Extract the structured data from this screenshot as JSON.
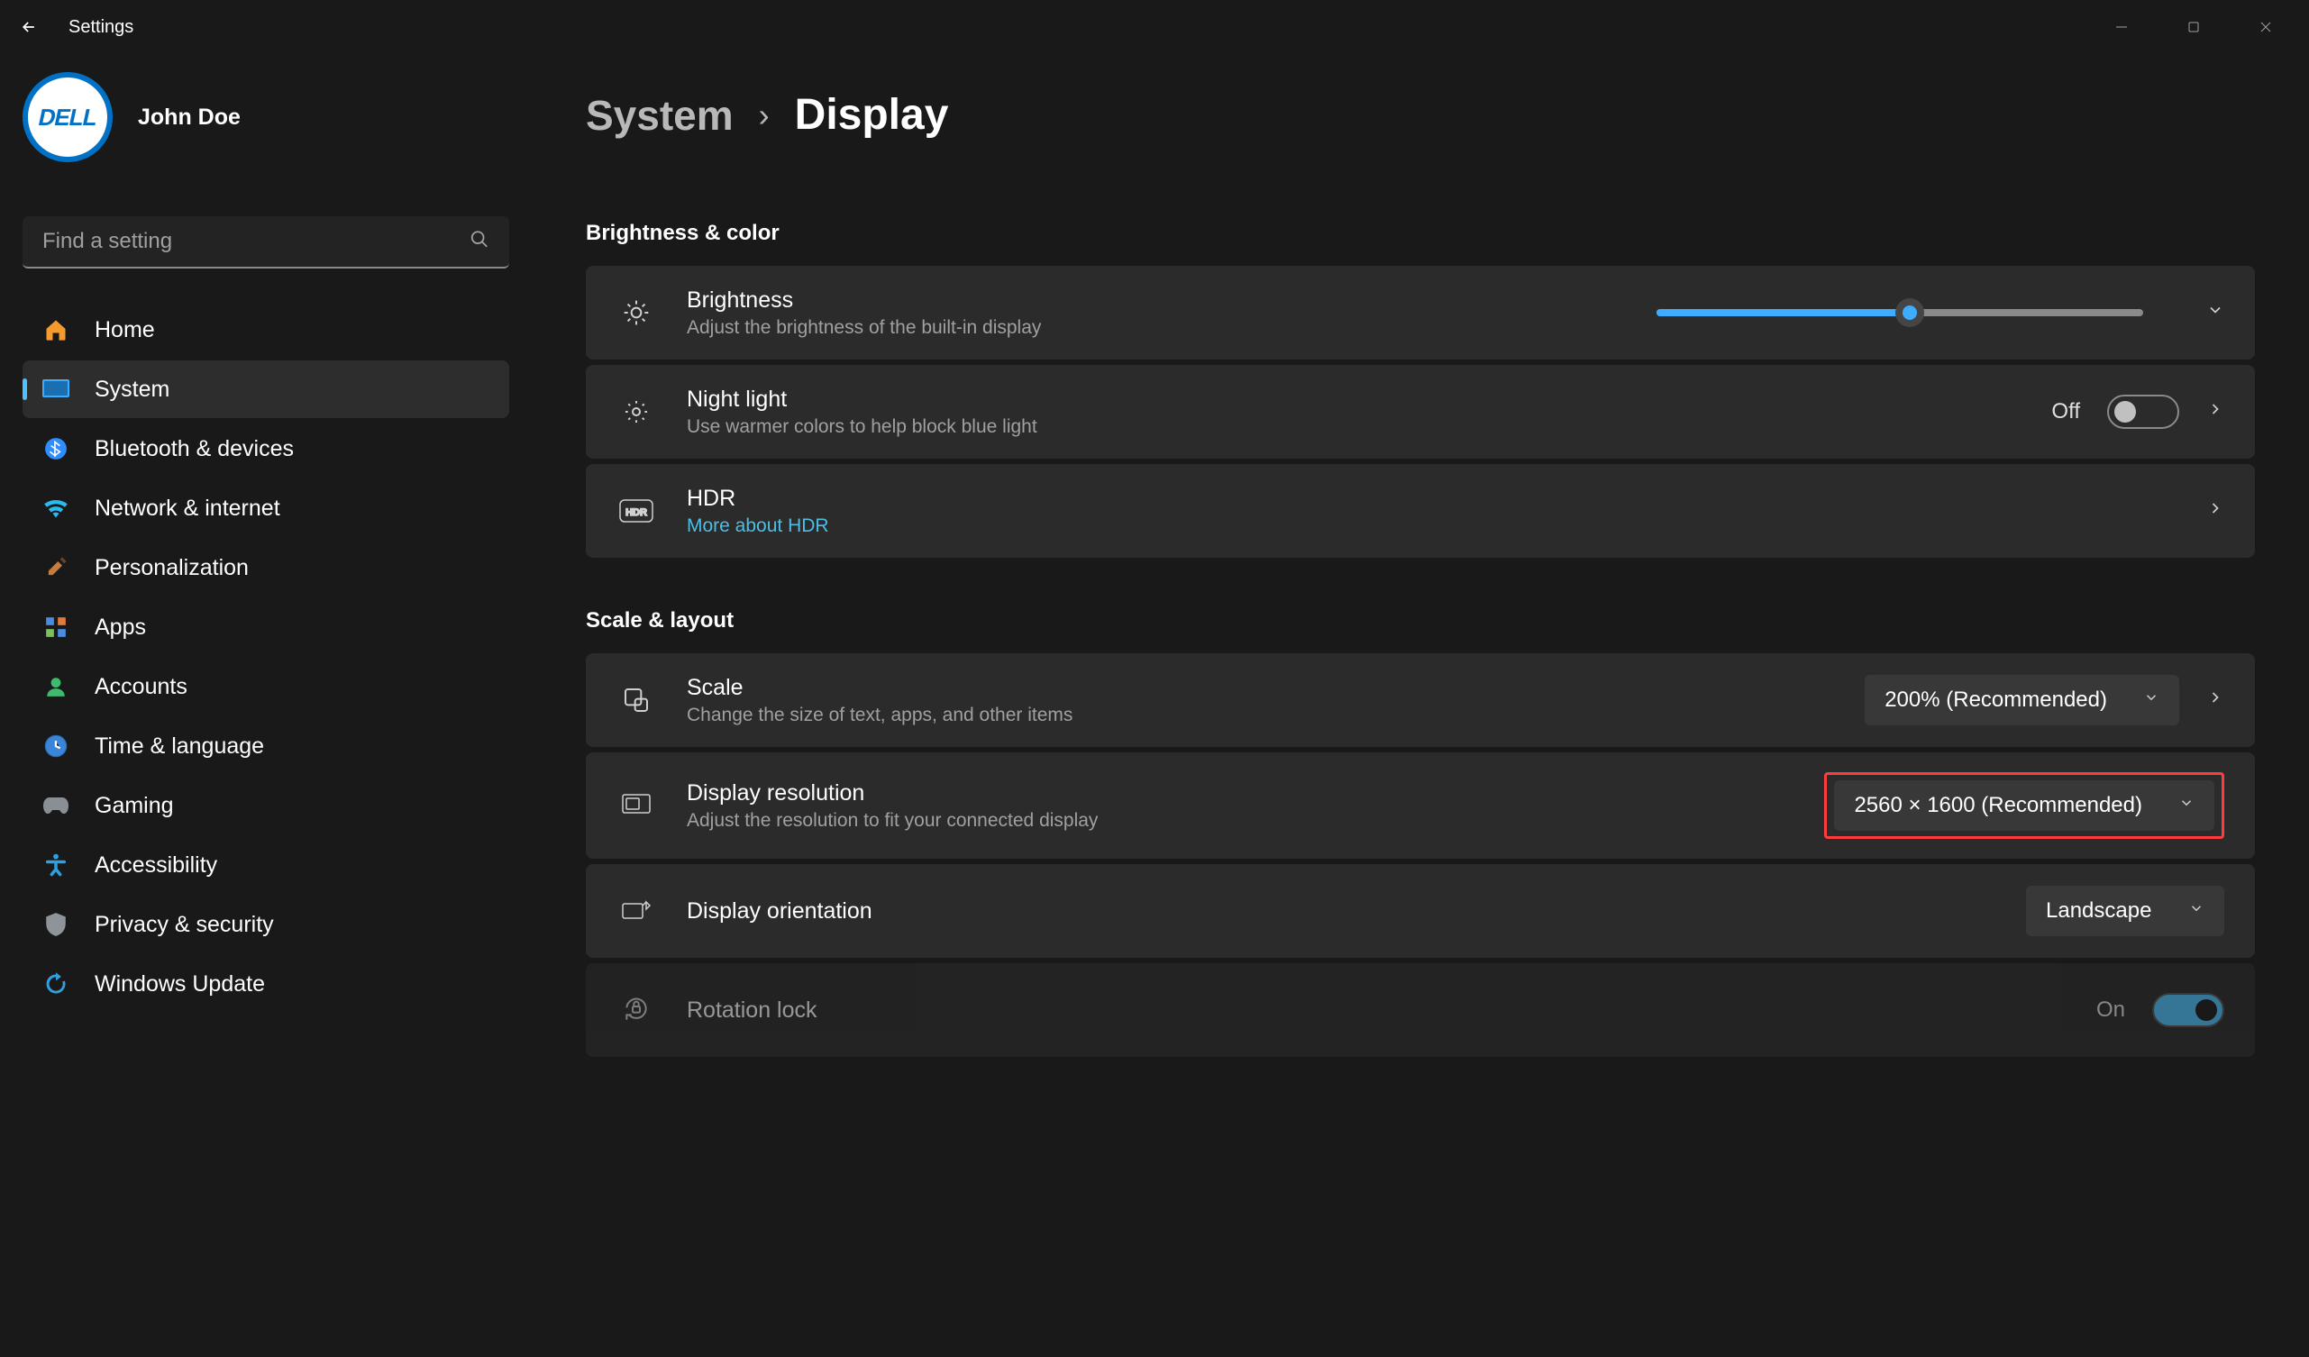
{
  "window": {
    "title": "Settings"
  },
  "user": {
    "name": "John Doe",
    "avatar_text": "DELL"
  },
  "search": {
    "placeholder": "Find a setting"
  },
  "nav": {
    "items": [
      {
        "id": "home",
        "label": "Home"
      },
      {
        "id": "system",
        "label": "System"
      },
      {
        "id": "bluetooth",
        "label": "Bluetooth & devices"
      },
      {
        "id": "network",
        "label": "Network & internet"
      },
      {
        "id": "personalization",
        "label": "Personalization"
      },
      {
        "id": "apps",
        "label": "Apps"
      },
      {
        "id": "accounts",
        "label": "Accounts"
      },
      {
        "id": "time",
        "label": "Time & language"
      },
      {
        "id": "gaming",
        "label": "Gaming"
      },
      {
        "id": "accessibility",
        "label": "Accessibility"
      },
      {
        "id": "privacy",
        "label": "Privacy & security"
      },
      {
        "id": "update",
        "label": "Windows Update"
      }
    ],
    "active": "system"
  },
  "breadcrumb": {
    "parent": "System",
    "current": "Display"
  },
  "sections": {
    "brightness_color": {
      "title": "Brightness & color",
      "brightness": {
        "title": "Brightness",
        "sub": "Adjust the brightness of the built-in display",
        "value_pct": 52
      },
      "night_light": {
        "title": "Night light",
        "sub": "Use warmer colors to help block blue light",
        "state_label": "Off",
        "on": false
      },
      "hdr": {
        "title": "HDR",
        "link": "More about HDR"
      }
    },
    "scale_layout": {
      "title": "Scale & layout",
      "scale": {
        "title": "Scale",
        "sub": "Change the size of text, apps, and other items",
        "value": "200% (Recommended)"
      },
      "resolution": {
        "title": "Display resolution",
        "sub": "Adjust the resolution to fit your connected display",
        "value": "2560 × 1600 (Recommended)",
        "highlighted": true
      },
      "orientation": {
        "title": "Display orientation",
        "value": "Landscape"
      },
      "rotation_lock": {
        "title": "Rotation lock",
        "state_label": "On",
        "on": true,
        "disabled": true
      }
    }
  },
  "colors": {
    "accent": "#4cc2ff",
    "highlight": "#ff3d3d"
  }
}
